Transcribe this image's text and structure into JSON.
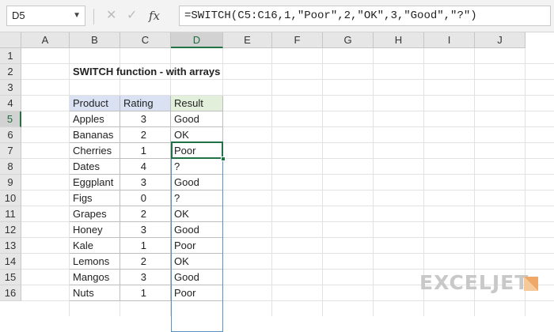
{
  "formula_bar": {
    "name_box": "D5",
    "formula": "=SWITCH(C5:C16,1,\"Poor\",2,\"OK\",3,\"Good\",\"?\")"
  },
  "icons": {
    "name_box_dropdown": "chevron-down-icon",
    "cancel": "cancel-icon",
    "enter": "enter-icon",
    "function": "fx-icon"
  },
  "columns": [
    "A",
    "B",
    "C",
    "D",
    "E",
    "F",
    "G",
    "H",
    "I",
    "J"
  ],
  "rows": [
    "1",
    "2",
    "3",
    "4",
    "5",
    "6",
    "7",
    "8",
    "9",
    "10",
    "11",
    "12",
    "13",
    "14",
    "15",
    "16"
  ],
  "sheet": {
    "title": "SWITCH function - with arrays",
    "table": {
      "headers": [
        "Product",
        "Rating",
        "Result"
      ],
      "rows": [
        [
          "Apples",
          "3",
          "Good"
        ],
        [
          "Bananas",
          "2",
          "OK"
        ],
        [
          "Cherries",
          "1",
          "Poor"
        ],
        [
          "Dates",
          "4",
          "?"
        ],
        [
          "Eggplant",
          "3",
          "Good"
        ],
        [
          "Figs",
          "0",
          "?"
        ],
        [
          "Grapes",
          "2",
          "OK"
        ],
        [
          "Honey",
          "3",
          "Good"
        ],
        [
          "Kale",
          "1",
          "Poor"
        ],
        [
          "Lemons",
          "2",
          "OK"
        ],
        [
          "Mangos",
          "3",
          "Good"
        ],
        [
          "Nuts",
          "1",
          "Poor"
        ]
      ]
    }
  },
  "selection": {
    "active_cell": "D5",
    "active_column": "D",
    "active_row": "5"
  },
  "logo": {
    "text": "EXCELJET"
  },
  "colors": {
    "accent": "#217346",
    "header_blue": "#d9e1f2",
    "header_green": "#e2efda",
    "spill_border": "#5b8fc7"
  }
}
